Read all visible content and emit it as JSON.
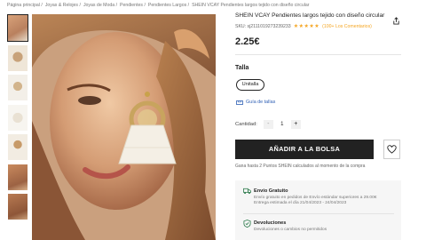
{
  "breadcrumb": [
    "Página principal",
    "Joyas & Relojes",
    "Joyas de Moda",
    "Pendientes",
    "Pendientes Largos",
    "SHEIN VCAY Pendientes largos tejido con diseño circular"
  ],
  "breadcrumb_sep": "/",
  "product": {
    "title": "SHEIN VCAY Pendientes largos tejido con diseño circular",
    "sku": "SKU: sj2111019273239233",
    "stars": "★★★★★",
    "reviews": "(100+ Los Comentarios)",
    "price": "2.25€"
  },
  "size": {
    "label": "Talla",
    "selected": "Unitalla",
    "guide": "Guía de tallas"
  },
  "quantity": {
    "label": "Cantidad:",
    "minus": "-",
    "value": "1",
    "plus": "+"
  },
  "actions": {
    "add_to_bag": "AÑADIR A LA BOLSA",
    "points_note": "Gana hasta 2 Puntos SHEIN calculados al momento de la compra"
  },
  "shipping": {
    "title": "Envío Gratuito",
    "line1": "Envío gratuito en pedidos de Envío estándar superiores a 29.00€",
    "line2": "Entrega estimada el día 21/04/2023 - 24/04/2023"
  },
  "returns": {
    "title": "Devoluciones",
    "line1": "Devoluciones o cambios no permitidos"
  },
  "colors": {
    "accent": "#222222",
    "star": "#f5a623",
    "link": "#2e5fb4",
    "ship_icon": "#2c7a4b"
  },
  "icons": {
    "share": "share-icon",
    "wishlist": "heart-icon",
    "size_guide": "ruler-icon",
    "shipping": "truck-icon",
    "returns": "shield-check-icon"
  }
}
